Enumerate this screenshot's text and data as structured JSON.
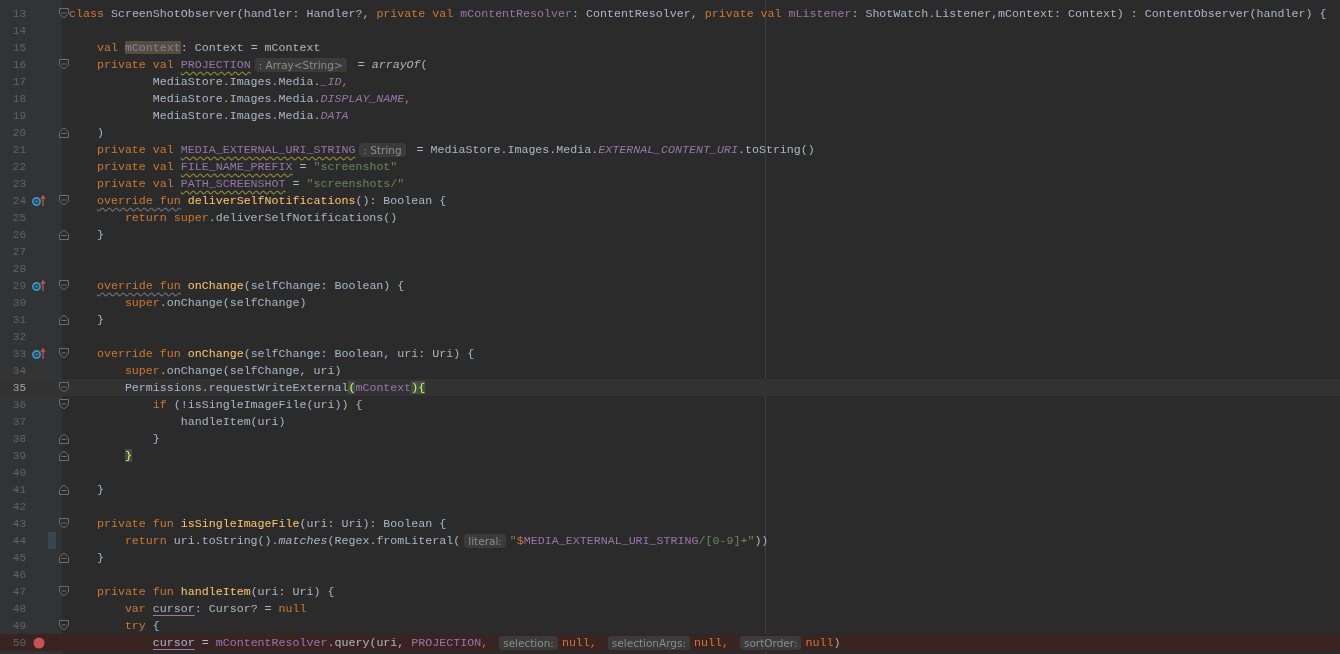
{
  "editor": {
    "lines": [
      {
        "number": "13",
        "fold": {
          "kind": "start"
        },
        "current": false,
        "tokens": [
          {
            "text": "class",
            "kind": "kw"
          },
          {
            "text": " ScreenShotObserver(handler: Handler?, ",
            "kind": "id"
          },
          {
            "text": "private val ",
            "kind": "kw"
          },
          {
            "text": "mContentResolver",
            "kind": "fld"
          },
          {
            "text": ": ContentResolver, ",
            "kind": "id"
          },
          {
            "text": "private val ",
            "kind": "kw"
          },
          {
            "text": "mListener",
            "kind": "fld"
          },
          {
            "text": ": ShotWatch.Listener,mContext: Context) : ContentObserver(handler) {",
            "kind": "id"
          }
        ]
      },
      {
        "number": "14",
        "current": false
      },
      {
        "number": "15",
        "current": false,
        "tokens": [
          {
            "text": "    val ",
            "kind": "kw"
          },
          {
            "text": "mContext",
            "kind": "usage"
          },
          {
            "text": ": Context = mContext",
            "kind": "id"
          }
        ]
      },
      {
        "number": "16",
        "fold": {
          "kind": "start"
        },
        "current": false,
        "tokens": [
          {
            "text": "    private val ",
            "kind": "kw"
          },
          {
            "text": "PROJECTION",
            "kind": "warn"
          },
          {
            "text": ": Array<String>",
            "kind": "hint"
          },
          {
            "text": " = ",
            "kind": "id"
          },
          {
            "text": "arrayOf",
            "kind": "it"
          },
          {
            "text": "(",
            "kind": "id"
          }
        ]
      },
      {
        "number": "17",
        "current": false,
        "tokens": [
          {
            "text": "            MediaStore.Images.Media.",
            "kind": "id"
          },
          {
            "text": "_ID",
            "kind": "ifld"
          },
          {
            "text": ",",
            "kind": "kw"
          }
        ]
      },
      {
        "number": "18",
        "current": false,
        "tokens": [
          {
            "text": "            MediaStore.Images.Media.",
            "kind": "id"
          },
          {
            "text": "DISPLAY_NAME",
            "kind": "ifld"
          },
          {
            "text": ",",
            "kind": "kw"
          }
        ]
      },
      {
        "number": "19",
        "current": false,
        "tokens": [
          {
            "text": "            MediaStore.Images.Media.",
            "kind": "id"
          },
          {
            "text": "DATA",
            "kind": "ifld"
          }
        ]
      },
      {
        "number": "20",
        "fold": {
          "kind": "end"
        },
        "current": false,
        "tokens": [
          {
            "text": "    )",
            "kind": "id"
          }
        ]
      },
      {
        "number": "21",
        "current": false,
        "tokens": [
          {
            "text": "    private val ",
            "kind": "kw"
          },
          {
            "text": "MEDIA_EXTERNAL_URI_STRING",
            "kind": "warn"
          },
          {
            "text": ": String",
            "kind": "hint"
          },
          {
            "text": " = MediaStore.Images.Media.",
            "kind": "id"
          },
          {
            "text": "EXTERNAL_CONTENT_URI",
            "kind": "ifld"
          },
          {
            "text": ".toString()",
            "kind": "id"
          }
        ]
      },
      {
        "number": "22",
        "current": false,
        "tokens": [
          {
            "text": "    private val ",
            "kind": "kw"
          },
          {
            "text": "FILE_NAME_PREFIX",
            "kind": "warn"
          },
          {
            "text": " = ",
            "kind": "id"
          },
          {
            "text": "\"screenshot\"",
            "kind": "str"
          }
        ]
      },
      {
        "number": "23",
        "current": false,
        "tokens": [
          {
            "text": "    private val ",
            "kind": "kw"
          },
          {
            "text": "PATH_SCREENSHOT",
            "kind": "warn"
          },
          {
            "text": " = ",
            "kind": "id"
          },
          {
            "text": "\"screenshots/\"",
            "kind": "str"
          }
        ]
      },
      {
        "number": "24",
        "gutter_icon": {
          "kind": "override"
        },
        "fold": {
          "kind": "start"
        },
        "current": false,
        "tokens": [
          {
            "text": "    override fun",
            "kind": "owarn"
          },
          {
            "text": " deliverSelfNotifications",
            "kind": "fn"
          },
          {
            "text": "(): Boolean {",
            "kind": "id"
          }
        ]
      },
      {
        "number": "25",
        "current": false,
        "tokens": [
          {
            "text": "        return super",
            "kind": "kw"
          },
          {
            "text": ".deliverSelfNotifications()",
            "kind": "id"
          }
        ]
      },
      {
        "number": "26",
        "fold": {
          "kind": "end"
        },
        "current": false,
        "tokens": [
          {
            "text": "    }",
            "kind": "id"
          }
        ]
      },
      {
        "number": "27",
        "current": false
      },
      {
        "number": "28",
        "current": false
      },
      {
        "number": "29",
        "gutter_icon": {
          "kind": "override"
        },
        "fold": {
          "kind": "start"
        },
        "current": false,
        "tokens": [
          {
            "text": "    override fun",
            "kind": "owarn"
          },
          {
            "text": " onChange",
            "kind": "fn"
          },
          {
            "text": "(selfChange: Boolean) {",
            "kind": "id"
          }
        ]
      },
      {
        "number": "30",
        "current": false,
        "tokens": [
          {
            "text": "        super",
            "kind": "kw"
          },
          {
            "text": ".onChange(selfChange)",
            "kind": "id"
          }
        ]
      },
      {
        "number": "31",
        "fold": {
          "kind": "end"
        },
        "current": false,
        "tokens": [
          {
            "text": "    }",
            "kind": "id"
          }
        ]
      },
      {
        "number": "32",
        "current": false
      },
      {
        "number": "33",
        "gutter_icon": {
          "kind": "override"
        },
        "fold": {
          "kind": "start"
        },
        "current": false,
        "tokens": [
          {
            "text": "    override fun ",
            "kind": "kw"
          },
          {
            "text": "onChange",
            "kind": "fn"
          },
          {
            "text": "(selfChange: Boolean, uri: Uri) {",
            "kind": "id"
          }
        ]
      },
      {
        "number": "34",
        "current": false,
        "tokens": [
          {
            "text": "        super",
            "kind": "kw"
          },
          {
            "text": ".onChange(selfChange, uri)",
            "kind": "id"
          }
        ]
      },
      {
        "number": "35",
        "fold": {
          "kind": "start"
        },
        "current": true,
        "tokens": [
          {
            "text": "        Permissions.requestWriteExternal",
            "kind": "id"
          },
          {
            "text": "(",
            "kind": "brace"
          },
          {
            "text": "mContext",
            "kind": "fld"
          },
          {
            "text": ")",
            "kind": "brace"
          },
          {
            "text": "{",
            "kind": "brace"
          }
        ]
      },
      {
        "number": "36",
        "fold": {
          "kind": "start"
        },
        "current": false,
        "tokens": [
          {
            "text": "            if ",
            "kind": "kw"
          },
          {
            "text": "(!isSingleImageFile(uri)) {",
            "kind": "id"
          }
        ]
      },
      {
        "number": "37",
        "current": false,
        "tokens": [
          {
            "text": "                handleItem(uri)",
            "kind": "id"
          }
        ]
      },
      {
        "number": "38",
        "fold": {
          "kind": "end"
        },
        "current": false,
        "tokens": [
          {
            "text": "            }",
            "kind": "id"
          }
        ]
      },
      {
        "number": "39",
        "fold": {
          "kind": "end"
        },
        "current": false,
        "tokens": [
          {
            "text": "        }",
            "kind": "brace"
          }
        ]
      },
      {
        "number": "40",
        "current": false
      },
      {
        "number": "41",
        "fold": {
          "kind": "end"
        },
        "current": false,
        "tokens": [
          {
            "text": "    }",
            "kind": "id"
          }
        ]
      },
      {
        "number": "42",
        "current": false
      },
      {
        "number": "43",
        "fold": {
          "kind": "start"
        },
        "current": false,
        "tokens": [
          {
            "text": "    private fun ",
            "kind": "kw"
          },
          {
            "text": "isSingleImageFile",
            "kind": "fn"
          },
          {
            "text": "(uri: Uri): Boolean {",
            "kind": "id"
          }
        ]
      },
      {
        "number": "44",
        "current": false,
        "change_marker": {
          "kind": "modified"
        },
        "tokens": [
          {
            "text": "        return ",
            "kind": "kw"
          },
          {
            "text": "uri.toString().",
            "kind": "id"
          },
          {
            "text": "matches",
            "kind": "it"
          },
          {
            "text": "(Regex.fromLiteral(",
            "kind": "id"
          },
          {
            "text": "literal:",
            "kind": "hint"
          },
          {
            "text": "\"",
            "kind": "str"
          },
          {
            "text": "$",
            "kind": "kw"
          },
          {
            "text": "MEDIA_EXTERNAL_URI_STRING",
            "kind": "fld"
          },
          {
            "text": "/[0-9]+\"",
            "kind": "str"
          },
          {
            "text": "))",
            "kind": "id"
          }
        ]
      },
      {
        "number": "45",
        "fold": {
          "kind": "end"
        },
        "current": false,
        "tokens": [
          {
            "text": "    }",
            "kind": "id"
          }
        ]
      },
      {
        "number": "46",
        "current": false
      },
      {
        "number": "47",
        "fold": {
          "kind": "start"
        },
        "current": false,
        "tokens": [
          {
            "text": "    private fun ",
            "kind": "kw"
          },
          {
            "text": "handleItem",
            "kind": "fn"
          },
          {
            "text": "(uri: Uri) {",
            "kind": "id"
          }
        ]
      },
      {
        "number": "48",
        "current": false,
        "tokens": [
          {
            "text": "        var ",
            "kind": "kw"
          },
          {
            "text": "cursor",
            "kind": "ul"
          },
          {
            "text": ": Cursor? = ",
            "kind": "id"
          },
          {
            "text": "null",
            "kind": "kw"
          }
        ]
      },
      {
        "number": "49",
        "fold": {
          "kind": "start"
        },
        "current": false,
        "tokens": [
          {
            "text": "        try ",
            "kind": "kw"
          },
          {
            "text": "{",
            "kind": "id"
          }
        ]
      },
      {
        "number": "50",
        "gutter_icon": {
          "kind": "breakpoint"
        },
        "current": false,
        "tokens": [
          {
            "text": "            cursor",
            "kind": "ul"
          },
          {
            "text": " = ",
            "kind": "id"
          },
          {
            "text": "mContentResolver",
            "kind": "fld"
          },
          {
            "text": ".query(uri, ",
            "kind": "id"
          },
          {
            "text": "PROJECTION",
            "kind": "fld"
          },
          {
            "text": ", ",
            "kind": "kw"
          },
          {
            "text": "selection:",
            "kind": "hint"
          },
          {
            "text": "null",
            "kind": "kw"
          },
          {
            "text": ", ",
            "kind": "kw"
          },
          {
            "text": "selectionArgs:",
            "kind": "hint"
          },
          {
            "text": "null",
            "kind": "kw"
          },
          {
            "text": ", ",
            "kind": "kw"
          },
          {
            "text": "sortOrder:",
            "kind": "hint"
          },
          {
            "text": "null",
            "kind": "kw"
          },
          {
            "text": ")",
            "kind": "id"
          }
        ]
      }
    ]
  }
}
